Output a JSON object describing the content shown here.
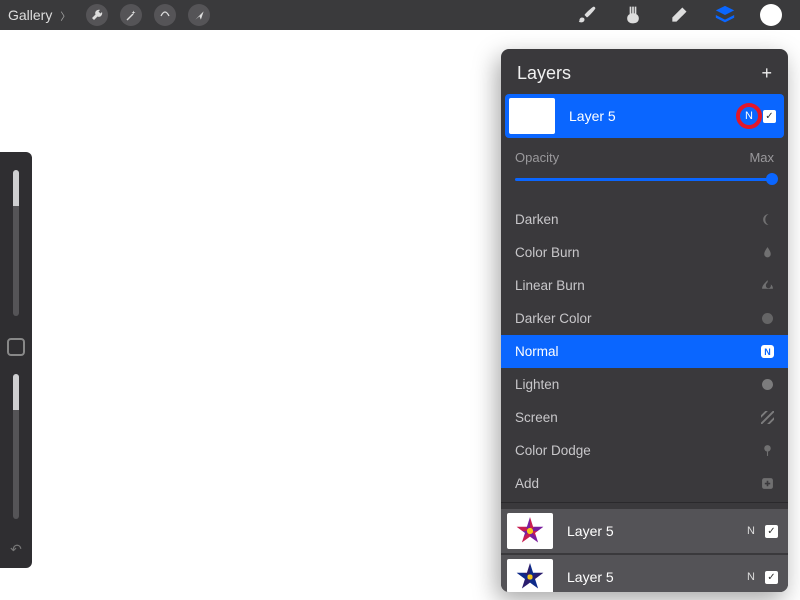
{
  "topbar": {
    "gallery_label": "Gallery",
    "tools": [
      "wrench-icon",
      "wand-icon",
      "s-tool-icon",
      "arrow-icon"
    ],
    "right": [
      "brush-icon",
      "smudge-icon",
      "eraser-icon",
      "layers-icon",
      "color-swatch"
    ]
  },
  "side_tools": {
    "square": true,
    "undo": "↶"
  },
  "panel": {
    "title": "Layers",
    "add": "+",
    "selected_layer": {
      "name": "Layer 5",
      "blend_letter": "N",
      "checked": true
    },
    "opacity": {
      "label": "Opacity",
      "value_label": "Max"
    },
    "blend_modes": [
      {
        "name": "Darken",
        "icon": "moon"
      },
      {
        "name": "Color Burn",
        "icon": "drop"
      },
      {
        "name": "Linear Burn",
        "icon": "flame"
      },
      {
        "name": "Darker Color",
        "icon": "dot"
      },
      {
        "name": "Normal",
        "selected": true,
        "icon": "N"
      },
      {
        "name": "Lighten",
        "icon": "dot"
      },
      {
        "name": "Screen",
        "icon": "hatch"
      },
      {
        "name": "Color Dodge",
        "icon": "lollipop"
      },
      {
        "name": "Add",
        "icon": "plus"
      }
    ],
    "other_layers": [
      {
        "name": "Layer 5",
        "blend_letter": "N",
        "checked": true,
        "thumb": "flower-red"
      },
      {
        "name": "Layer 5",
        "blend_letter": "N",
        "checked": true,
        "thumb": "flower-blue"
      }
    ]
  },
  "highlight": {
    "target": "blend-letter-N"
  }
}
